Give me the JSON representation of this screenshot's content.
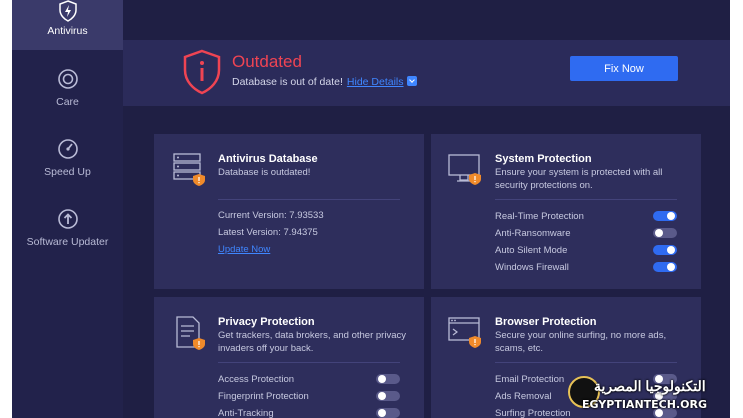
{
  "sidebar": {
    "items": [
      {
        "label": "Antivirus",
        "icon": "shield-icon",
        "active": true
      },
      {
        "label": "Care",
        "icon": "care-icon",
        "active": false
      },
      {
        "label": "Speed Up",
        "icon": "speedometer-icon",
        "active": false
      },
      {
        "label": "Software Updater",
        "icon": "update-icon",
        "active": false
      }
    ]
  },
  "status": {
    "title": "Outdated",
    "message": "Database is out of date!",
    "details_link": "Hide Details",
    "fix_button": "Fix Now"
  },
  "cards": {
    "database": {
      "title": "Antivirus Database",
      "description": "Database is outdated!",
      "current_version": "Current Version: 7.93533",
      "latest_version": "Latest Version: 7.94375",
      "update_link": "Update Now"
    },
    "system": {
      "title": "System Protection",
      "description": "Ensure your system is protected with all security protections on.",
      "rows": [
        {
          "label": "Real-Time Protection",
          "on": true
        },
        {
          "label": "Anti-Ransomware",
          "on": false
        },
        {
          "label": "Auto Silent Mode",
          "on": true
        },
        {
          "label": "Windows Firewall",
          "on": true
        }
      ]
    },
    "privacy": {
      "title": "Privacy Protection",
      "description": "Get trackers, data brokers, and other privacy invaders off your back.",
      "rows": [
        {
          "label": "Access Protection",
          "on": false
        },
        {
          "label": "Fingerprint Protection",
          "on": false
        },
        {
          "label": "Anti-Tracking",
          "on": false
        }
      ]
    },
    "browser": {
      "title": "Browser Protection",
      "description": "Secure your online surfing, no more ads, scams, etc.",
      "rows": [
        {
          "label": "Email Protection",
          "on": false
        },
        {
          "label": "Ads Removal",
          "on": false
        },
        {
          "label": "Surfing Protection",
          "on": false
        }
      ]
    }
  },
  "watermark": {
    "arabic": "التكنولوجيا المصرية",
    "english": "EGYPTIANTECH.ORG"
  },
  "colors": {
    "accent": "#2f6bf1",
    "danger": "#ef4453",
    "warning": "#f08a2a",
    "sidebar": "#22224b",
    "card": "#2e2e5c"
  }
}
